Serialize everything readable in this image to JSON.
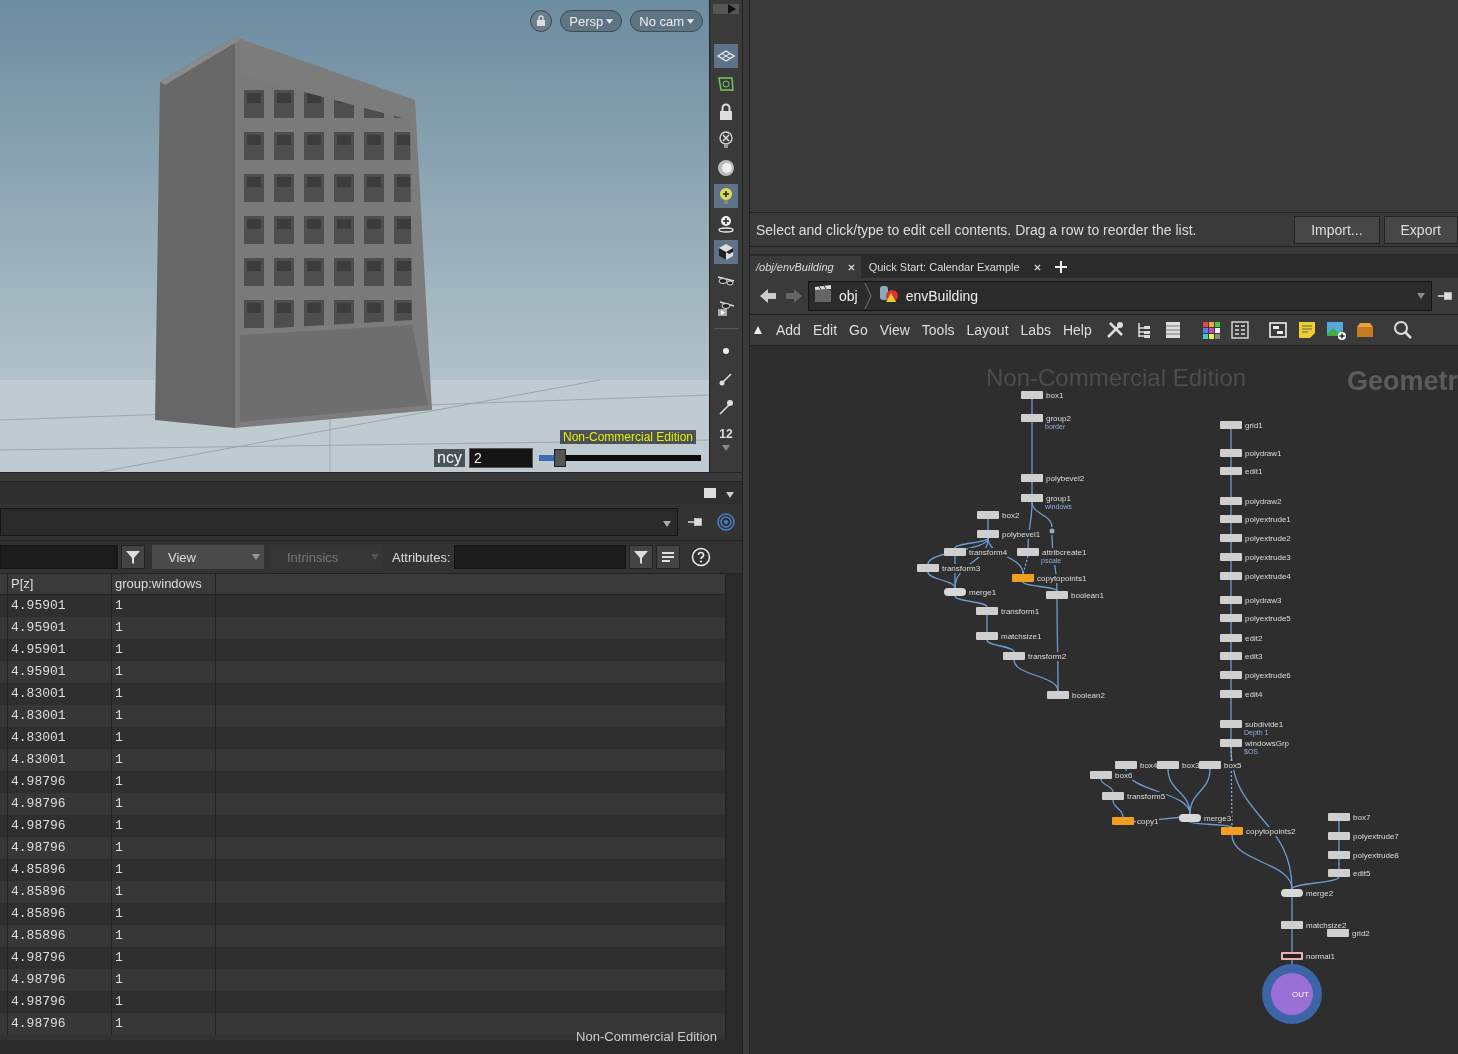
{
  "viewport": {
    "projection": "Persp",
    "camera": "No cam",
    "param_label": "ncy",
    "param_value": "2",
    "slider": {
      "level": 0.13
    },
    "watermark": "Non-Commercial Edition",
    "frame": "12",
    "tools": [
      {
        "on": true
      },
      {
        "on": false
      },
      {
        "on": false
      },
      {
        "on": false
      },
      {
        "on": false
      },
      {
        "on": true
      },
      {
        "on": false
      },
      {
        "on": true
      },
      {
        "on": false
      },
      {
        "on": false
      },
      {
        "on": false
      },
      {
        "on": false
      },
      {
        "on": false
      }
    ]
  },
  "spreadsheet": {
    "dropdowns": [
      {
        "label": "View",
        "disabled": false
      },
      {
        "label": "Intrinsics",
        "disabled": true
      }
    ],
    "attributes_label": "Attributes:",
    "columns": [
      "P[z]",
      "group:windows"
    ],
    "rows": [
      [
        "4.95901",
        "1"
      ],
      [
        "4.95901",
        "1"
      ],
      [
        "4.95901",
        "1"
      ],
      [
        "4.95901",
        "1"
      ],
      [
        "4.83001",
        "1"
      ],
      [
        "4.83001",
        "1"
      ],
      [
        "4.83001",
        "1"
      ],
      [
        "4.83001",
        "1"
      ],
      [
        "4.98796",
        "1"
      ],
      [
        "4.98796",
        "1"
      ],
      [
        "4.98796",
        "1"
      ],
      [
        "4.98796",
        "1"
      ],
      [
        "4.85896",
        "1"
      ],
      [
        "4.85896",
        "1"
      ],
      [
        "4.85896",
        "1"
      ],
      [
        "4.85896",
        "1"
      ],
      [
        "4.98796",
        "1"
      ],
      [
        "4.98796",
        "1"
      ],
      [
        "4.98796",
        "1"
      ],
      [
        "4.98796",
        "1"
      ]
    ],
    "watermark": "Non-Commercial Edition"
  },
  "message_bar": {
    "text": "Select and click/type to edit cell contents. Drag a row to reorder the list.",
    "buttons": [
      "Import...",
      "Export"
    ]
  },
  "tabs": [
    {
      "label": "/obj/envBuilding",
      "selected": true
    },
    {
      "label": "Quick Start: Calendar Example",
      "selected": false
    }
  ],
  "path": [
    "obj",
    "envBuilding"
  ],
  "menu": [
    "Add",
    "Edit",
    "Go",
    "View",
    "Tools",
    "Layout",
    "Labs",
    "Help"
  ],
  "network": {
    "watermark": "Non-Commercial Edition",
    "context_label": "Geometr",
    "nodes": [
      {
        "name": "box1",
        "kind": "plain"
      },
      {
        "name": "group2",
        "kind": "plain",
        "comment": "border"
      },
      {
        "name": "polybevel2",
        "kind": "plain"
      },
      {
        "name": "group1",
        "kind": "plain",
        "comment": "windows"
      },
      {
        "name": "box2",
        "kind": "plain"
      },
      {
        "name": "polybevel1",
        "kind": "plain"
      },
      {
        "name": "transform4",
        "kind": "plain"
      },
      {
        "name": "attribcreate1",
        "kind": "plain",
        "comment": "pscale"
      },
      {
        "name": "transform3",
        "kind": "plain"
      },
      {
        "name": "copytopoints1",
        "kind": "flagged"
      },
      {
        "name": "merge1",
        "kind": "merge"
      },
      {
        "name": "boolean1",
        "kind": "plain"
      },
      {
        "name": "transform1",
        "kind": "plain"
      },
      {
        "name": "matchsize1",
        "kind": "plain"
      },
      {
        "name": "transform2",
        "kind": "plain"
      },
      {
        "name": "boolean2",
        "kind": "plain"
      },
      {
        "name": "grid1",
        "kind": "plain"
      },
      {
        "name": "polydraw1",
        "kind": "plain"
      },
      {
        "name": "edit1",
        "kind": "plain"
      },
      {
        "name": "polydraw2",
        "kind": "plain"
      },
      {
        "name": "polyextrude1",
        "kind": "plain"
      },
      {
        "name": "polyextrude2",
        "kind": "plain"
      },
      {
        "name": "polyextrude3",
        "kind": "plain"
      },
      {
        "name": "polyextrude4",
        "kind": "plain"
      },
      {
        "name": "polydraw3",
        "kind": "plain"
      },
      {
        "name": "polyextrude5",
        "kind": "plain"
      },
      {
        "name": "edit2",
        "kind": "plain"
      },
      {
        "name": "edit3",
        "kind": "plain"
      },
      {
        "name": "polyextrude6",
        "kind": "plain"
      },
      {
        "name": "edit4",
        "kind": "plain"
      },
      {
        "name": "subdivide1",
        "kind": "plain",
        "comment": "Depth 1"
      },
      {
        "name": "windowsGrp",
        "kind": "plain",
        "comment": "$OS"
      },
      {
        "name": "box4",
        "kind": "plain"
      },
      {
        "name": "box3",
        "kind": "plain"
      },
      {
        "name": "box5",
        "kind": "plain"
      },
      {
        "name": "box6",
        "kind": "plain"
      },
      {
        "name": "transform5",
        "kind": "plain"
      },
      {
        "name": "copy1",
        "kind": "flagged"
      },
      {
        "name": "merge3",
        "kind": "merge"
      },
      {
        "name": "copytopoints2",
        "kind": "flagged"
      },
      {
        "name": "box7",
        "kind": "plain"
      },
      {
        "name": "polyextrude7",
        "kind": "plain"
      },
      {
        "name": "polyextrude8",
        "kind": "plain"
      },
      {
        "name": "edit5",
        "kind": "plain"
      },
      {
        "name": "merge2",
        "kind": "merge"
      },
      {
        "name": "matchsize2",
        "kind": "plain"
      },
      {
        "name": "grid2",
        "kind": "plain"
      },
      {
        "name": "normal1",
        "kind": "display"
      },
      {
        "name": "OUT",
        "kind": "output"
      }
    ]
  }
}
